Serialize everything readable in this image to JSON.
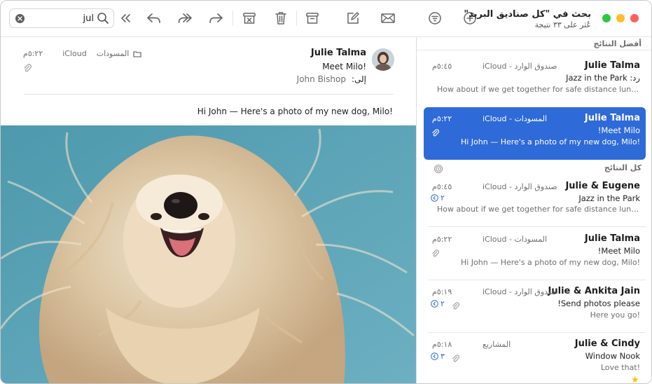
{
  "window": {
    "title": "بحث في \"كل صناديق البريد\"",
    "subtitle": "عُثر على ٣٣ نتيجة"
  },
  "search": {
    "value": "jul"
  },
  "toolbar": {
    "buttons": [
      "expand-sidebar",
      "reply",
      "reply-all",
      "forward",
      "junk",
      "trash",
      "archive",
      "compose",
      "new-message",
      "filter",
      "add"
    ]
  },
  "message": {
    "from": "Julie Talma",
    "subject": "Meet Milo!",
    "to_label": "إلى:",
    "to": "John Bishop",
    "mailbox": "المسودات",
    "account": "iCloud",
    "time": "٥:٢٢م",
    "body": "Hi John — Here's a photo of my new dog, Milo!"
  },
  "list": {
    "top_hits_label": "أفضل النتائج",
    "all_results_label": "كل النتائج",
    "items": [
      {
        "name": "Julie Talma",
        "subject": "رد: Jazz in the Park",
        "preview": "How about if we get together for safe distance lunch o…",
        "mailbox": "صندوق الوارد",
        "account": "iCloud",
        "time": "٥:٤٥م"
      },
      {
        "name": "Julie Talma",
        "subject": "Meet Milo!",
        "preview": "Hi John — Here's a photo of my new dog, Milo!",
        "mailbox": "المسودات",
        "account": "iCloud",
        "time": "٥:٢٢م"
      },
      {
        "name": "Julie & Eugene",
        "subject": "Jazz in the Park",
        "preview": "How about if we get together for safe distance lunch o…",
        "mailbox": "صندوق الوارد",
        "account": "iCloud",
        "time": "٥:٤٥م",
        "thread": "٢"
      },
      {
        "name": "Julie Talma",
        "subject": "Meet Milo!",
        "preview": "Hi John — Here's a photo of my new dog, Milo!",
        "mailbox": "المسودات",
        "account": "iCloud",
        "time": "٥:٢٢م"
      },
      {
        "name": "Julie & Ankita Jain",
        "subject": "Send photos please!",
        "preview": "Here you go!",
        "mailbox": "صندوق الوارد",
        "account": "iCloud",
        "time": "٥:١٩م",
        "thread": "٢"
      },
      {
        "name": "Julie & Cindy",
        "subject": "Window Nook",
        "preview": "Love that!",
        "mailbox": "المشاريع",
        "account": "",
        "time": "٥:١٨م",
        "thread": "٣"
      }
    ]
  },
  "colors": {
    "selection": "#2f6ad9",
    "close": "#ff5f57",
    "minimize": "#febc2e",
    "zoom": "#28c840",
    "star": "#f5c400"
  }
}
